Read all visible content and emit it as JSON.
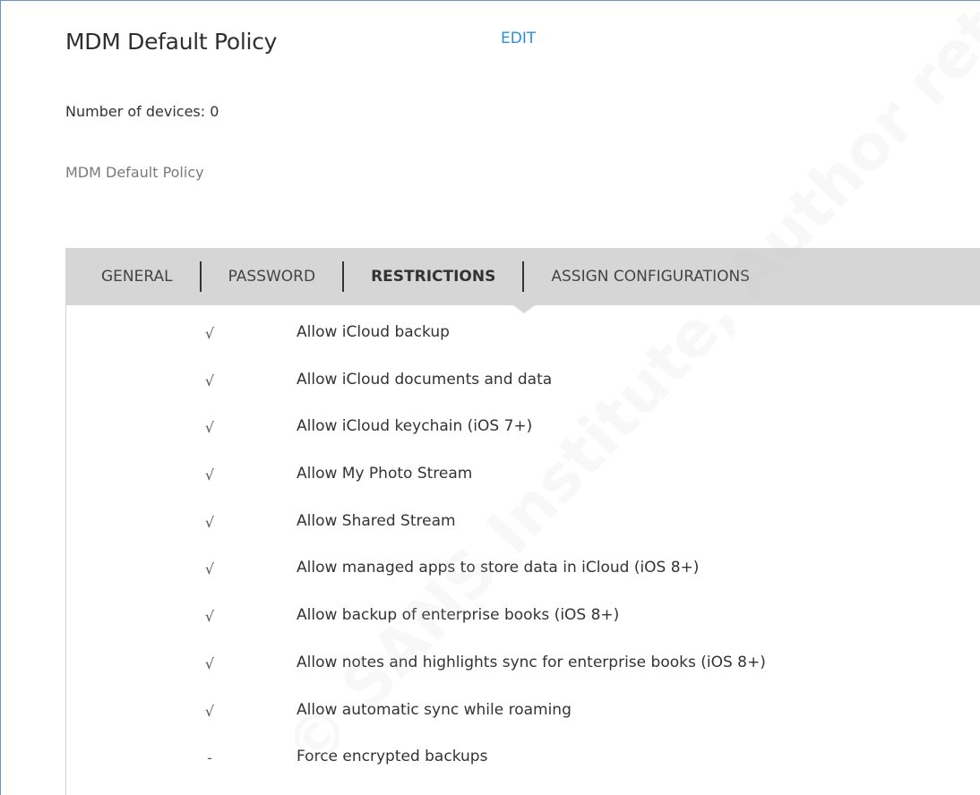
{
  "policy": {
    "title": "MDM Default Policy",
    "edit_label": "EDIT",
    "device_count_text": "Number of devices: 0",
    "description": "MDM Default Policy"
  },
  "tabs": [
    {
      "label": "GENERAL",
      "active": false
    },
    {
      "label": "PASSWORD",
      "active": false
    },
    {
      "label": "RESTRICTIONS",
      "active": true
    },
    {
      "label": "ASSIGN CONFIGURATIONS",
      "active": false
    }
  ],
  "restrictions": [
    {
      "mark": "√",
      "label": "Allow iCloud backup"
    },
    {
      "mark": "√",
      "label": "Allow iCloud documents and data"
    },
    {
      "mark": "√",
      "label": "Allow iCloud keychain (iOS 7+)"
    },
    {
      "mark": "√",
      "label": "Allow My Photo Stream"
    },
    {
      "mark": "√",
      "label": "Allow Shared Stream"
    },
    {
      "mark": "√",
      "label": "Allow managed apps to store data in iCloud (iOS 8+)"
    },
    {
      "mark": "√",
      "label": "Allow backup of enterprise books (iOS 8+)"
    },
    {
      "mark": "√",
      "label": "Allow notes and highlights sync for enterprise books (iOS 8+)"
    },
    {
      "mark": "√",
      "label": "Allow automatic sync while roaming"
    },
    {
      "mark": "-",
      "label": "Force encrypted backups"
    }
  ],
  "watermark_text": "© SANS Institute, Author retains full rights"
}
